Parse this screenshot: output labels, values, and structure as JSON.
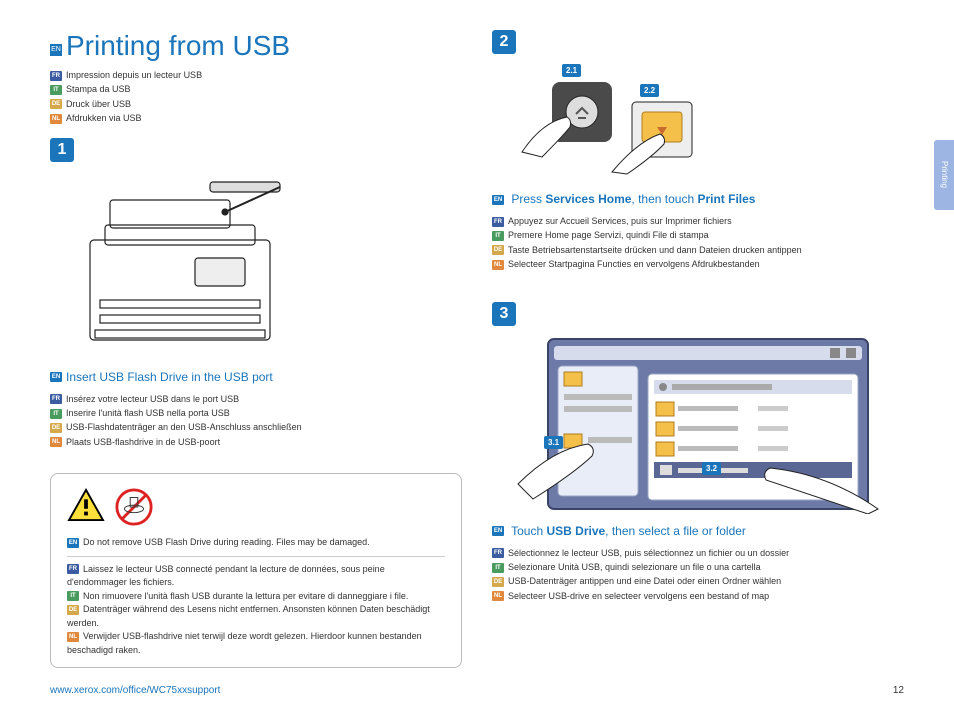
{
  "title": "Printing from USB",
  "title_flag": "EN",
  "translations": [
    {
      "flag": "FR",
      "text": "Impression depuis un lecteur USB"
    },
    {
      "flag": "IT",
      "text": "Stampa da USB"
    },
    {
      "flag": "DE",
      "text": "Druck über USB"
    },
    {
      "flag": "NL",
      "text": "Afdrukken via USB"
    }
  ],
  "step1": {
    "num": "1",
    "title_pre": "Insert USB Flash Drive in the USB port",
    "langs": [
      {
        "flag": "FR",
        "text": "Insérez votre lecteur USB dans le port USB"
      },
      {
        "flag": "IT",
        "text": "Inserire l'unità flash USB nella porta USB"
      },
      {
        "flag": "DE",
        "text": "USB-Flashdatenträger an den USB-Anschluss anschließen"
      },
      {
        "flag": "NL",
        "text": "Plaats USB-flashdrive in de USB-poort"
      }
    ]
  },
  "warning": {
    "en": "Do not remove USB Flash Drive during reading. Files may be damaged.",
    "langs": [
      {
        "flag": "FR",
        "text": "Laissez le lecteur USB connecté pendant la lecture de données, sous peine d'endommager les fichiers."
      },
      {
        "flag": "IT",
        "text": "Non rimuovere l'unità flash USB durante la lettura per evitare di danneggiare i file."
      },
      {
        "flag": "DE",
        "text": "Datenträger während des Lesens nicht entfernen. Ansonsten können Daten beschädigt werden."
      },
      {
        "flag": "NL",
        "text": "Verwijder USB-flashdrive niet terwijl deze wordt gelezen. Hierdoor kunnen bestanden beschadigd raken."
      }
    ]
  },
  "step2": {
    "num": "2",
    "sub1": "2.1",
    "sub2": "2.2",
    "title_html": [
      "Press ",
      "Services Home",
      ", then touch ",
      "Print Files"
    ],
    "langs": [
      {
        "flag": "FR",
        "text": "Appuyez sur Accueil Services, puis sur Imprimer fichiers"
      },
      {
        "flag": "IT",
        "text": "Premere Home page Servizi, quindi File di stampa"
      },
      {
        "flag": "DE",
        "text": "Taste Betriebsartenstartseite drücken und dann Dateien drucken antippen"
      },
      {
        "flag": "NL",
        "text": "Selecteer Startpagina Functies en vervolgens Afdrukbestanden"
      }
    ]
  },
  "step3": {
    "num": "3",
    "sub1": "3.1",
    "sub2": "3.2",
    "title_html": [
      "Touch ",
      "USB Drive",
      ", then select a file or folder"
    ],
    "langs": [
      {
        "flag": "FR",
        "text": "Sélectionnez le lecteur USB, puis sélectionnez un fichier ou un dossier"
      },
      {
        "flag": "IT",
        "text": "Selezionare Unità USB, quindi selezionare un file o una cartella"
      },
      {
        "flag": "DE",
        "text": "USB-Datenträger antippen und eine Datei oder einen Ordner wählen"
      },
      {
        "flag": "NL",
        "text": "Selecteer USB-drive en selecteer vervolgens een bestand of map"
      }
    ]
  },
  "footer": {
    "url": "www.xerox.com/office/WC75xxsupport",
    "page": "12"
  },
  "side_tab": "Printing"
}
